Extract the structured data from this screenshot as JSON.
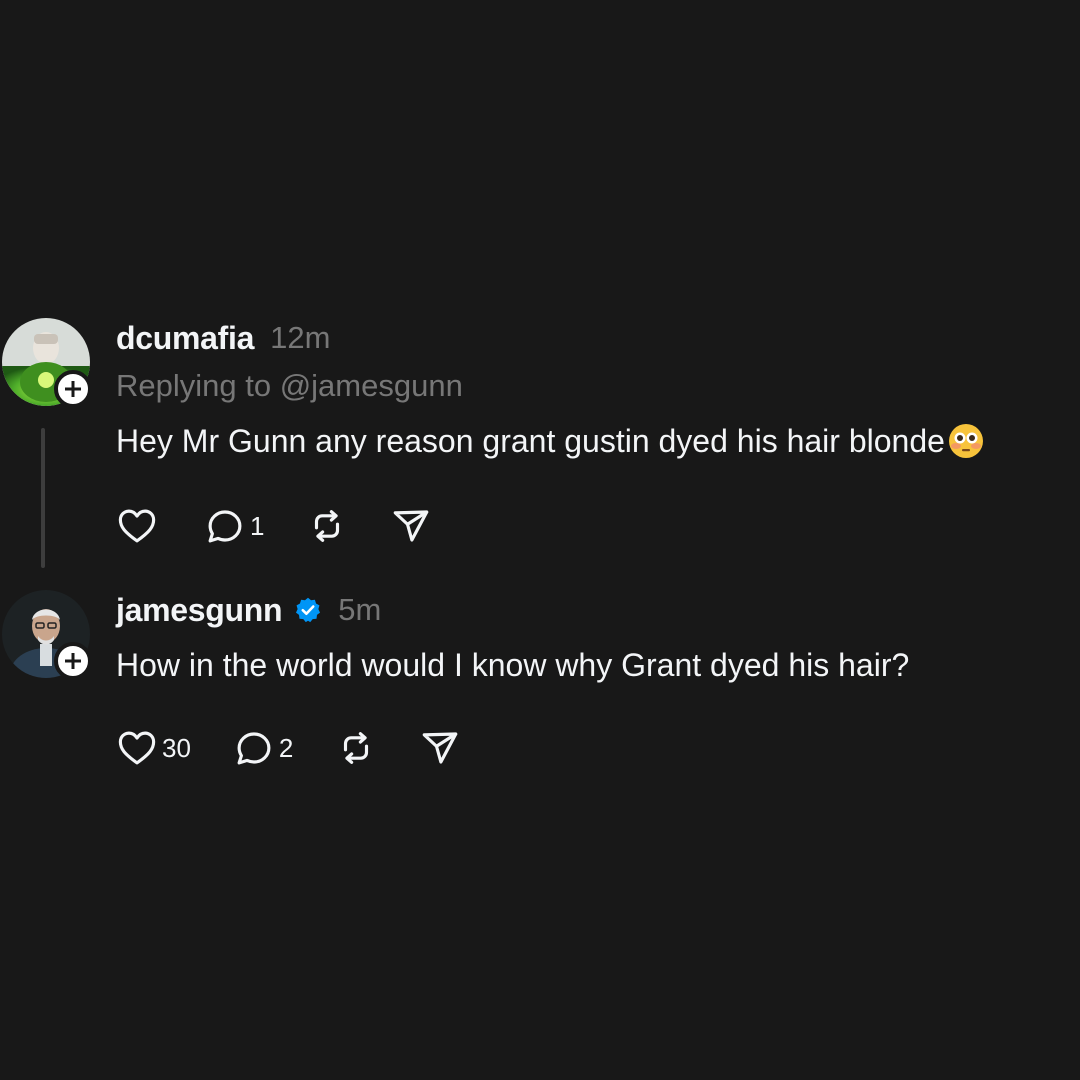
{
  "posts": [
    {
      "username": "dcumafia",
      "time": "12m",
      "replying_to": "Replying to @jamesgunn",
      "text": "Hey Mr Gunn any reason grant gustin dyed his hair blonde",
      "emoji": "flushed-face-emoji",
      "verified": false,
      "actions": {
        "like_count": "",
        "reply_count": "1",
        "repost_count": "",
        "share_count": ""
      }
    },
    {
      "username": "jamesgunn",
      "time": "5m",
      "verified": true,
      "text": "How in the world would I know why Grant dyed his hair?",
      "actions": {
        "like_count": "30",
        "reply_count": "2",
        "repost_count": "",
        "share_count": ""
      }
    }
  ],
  "colors": {
    "background": "#181818",
    "primary_text": "#f3f5f7",
    "secondary_text": "#777777",
    "verified_badge": "#0095f6",
    "thread_line": "#3d3d3d"
  },
  "icons": [
    "heart-icon",
    "comment-icon",
    "repost-icon",
    "share-icon",
    "plus-icon",
    "verified-icon"
  ]
}
